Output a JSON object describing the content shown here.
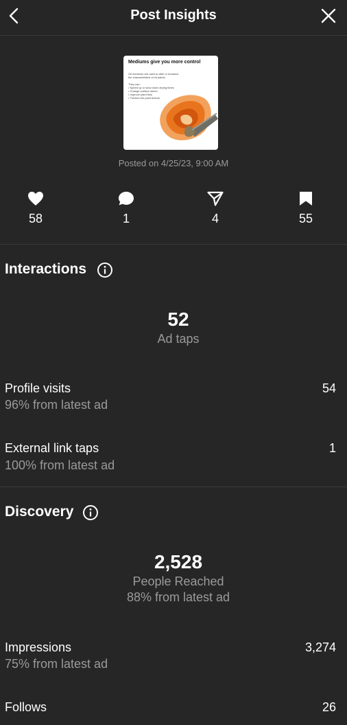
{
  "header": {
    "title": "Post Insights"
  },
  "post": {
    "thumbnail": {
      "title": "Mediums give you more control",
      "lines": [
        "Oil mediums are used to alter or enhance",
        "the characteristics of oil paints.",
        "",
        "They can:",
        "• Speed up or slow down drying times",
        "• Change surface sheen",
        "• Improve paint flow",
        "• Thicken the paint texture"
      ]
    },
    "posted_on": "Posted on 4/25/23, 9:00 AM"
  },
  "stats": {
    "likes": "58",
    "comments": "1",
    "shares": "4",
    "saves": "55"
  },
  "interactions": {
    "title": "Interactions",
    "ad_taps_value": "52",
    "ad_taps_label": "Ad taps",
    "profile_visits": {
      "label": "Profile visits",
      "sub": "96% from latest ad",
      "value": "54"
    },
    "external_link_taps": {
      "label": "External link taps",
      "sub": "100% from latest ad",
      "value": "1"
    }
  },
  "discovery": {
    "title": "Discovery",
    "reached_value": "2,528",
    "reached_label": "People Reached",
    "reached_sub": "88% from latest ad",
    "impressions": {
      "label": "Impressions",
      "sub": "75% from latest ad",
      "value": "3,274"
    },
    "follows": {
      "label": "Follows",
      "value": "26"
    }
  },
  "colors": {
    "background": "#262626",
    "text": "#ffffff",
    "muted": "#9a9a9a",
    "divider": "#3a3a3a"
  }
}
